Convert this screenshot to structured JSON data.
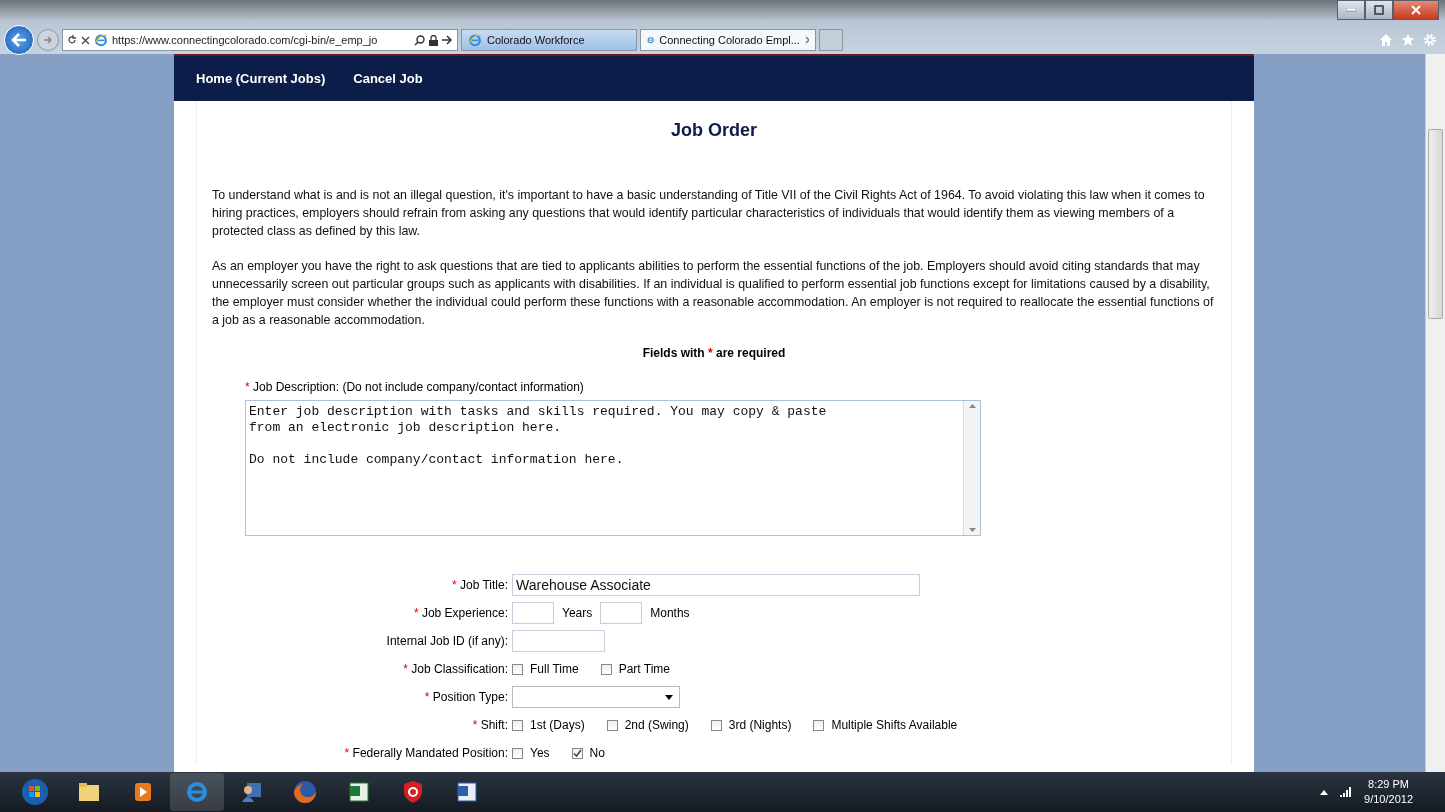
{
  "browser": {
    "url": "https://www.connectingcolorado.com/cgi-bin/e_emp_jo",
    "tabs": [
      {
        "title": "Colorado Workforce",
        "selected": false
      },
      {
        "title": "Connecting Colorado Empl...",
        "selected": true
      }
    ]
  },
  "nav": [
    "Home (Current Jobs)",
    "Cancel Job"
  ],
  "page": {
    "title": "Job Order",
    "paragraphs": [
      "To understand what is and is not an illegal question, it's important to have a basic understanding of Title VII of the Civil Rights Act of 1964. To avoid violating this law when it comes to hiring practices, employers should refrain from asking any questions that would identify particular characteristics of individuals that would identify them as viewing members of a protected class as defined by this law.",
      "As an employer you have the right to ask questions that are tied to applicants abilities to perform the essential functions of the job. Employers should avoid citing standards that may unnecessarily screen out particular groups such as applicants with disabilities. If an individual is qualified to perform essential job functions except for limitations caused by a disability, the employer must consider whether the individual could perform these functions with a reasonable accommodation. An employer is not required to reallocate the essential functions of a job as a reasonable accommodation."
    ],
    "required_note": {
      "before": "Fields with",
      "mark": "*",
      "after": "are required"
    },
    "description": {
      "required": true,
      "label": "Job Description: (Do not include company/contact information)",
      "value": "Enter job description with tasks and skills required. You may copy & paste\nfrom an electronic job description here.\n\nDo not include company/contact information here."
    },
    "fields": [
      {
        "kind": "text",
        "required": true,
        "label": "Job Title:",
        "value": "Warehouse Associate"
      },
      {
        "kind": "experience",
        "required": true,
        "label": "Job Experience:",
        "units": [
          "Years",
          "Months"
        ]
      },
      {
        "kind": "short",
        "required": false,
        "label": "Internal Job ID (if any):"
      },
      {
        "kind": "checks",
        "required": true,
        "label": "Job Classification:",
        "options": [
          {
            "label": "Full Time",
            "checked": false
          },
          {
            "label": "Part Time",
            "checked": false
          }
        ]
      },
      {
        "kind": "select",
        "required": true,
        "label": "Position Type:"
      },
      {
        "kind": "checks",
        "required": true,
        "label": "Shift:",
        "options": [
          {
            "label": "1st (Days)",
            "checked": false
          },
          {
            "label": "2nd (Swing)",
            "checked": false
          },
          {
            "label": "3rd (Nights)",
            "checked": false
          },
          {
            "label": "Multiple Shifts Available",
            "checked": false
          }
        ]
      },
      {
        "kind": "checks",
        "required": true,
        "label": "Federally Mandated Position:",
        "options": [
          {
            "label": "Yes",
            "checked": false
          },
          {
            "label": "No",
            "checked": true
          }
        ]
      }
    ]
  },
  "taskbar": {
    "apps": [
      {
        "kind": "start"
      },
      {
        "kind": "folder"
      },
      {
        "kind": "media"
      },
      {
        "kind": "ie"
      },
      {
        "kind": "user"
      },
      {
        "kind": "firefox"
      },
      {
        "kind": "excel"
      },
      {
        "kind": "shield"
      },
      {
        "kind": "word"
      }
    ],
    "time": "8:29 PM",
    "date": "9/10/2012"
  }
}
